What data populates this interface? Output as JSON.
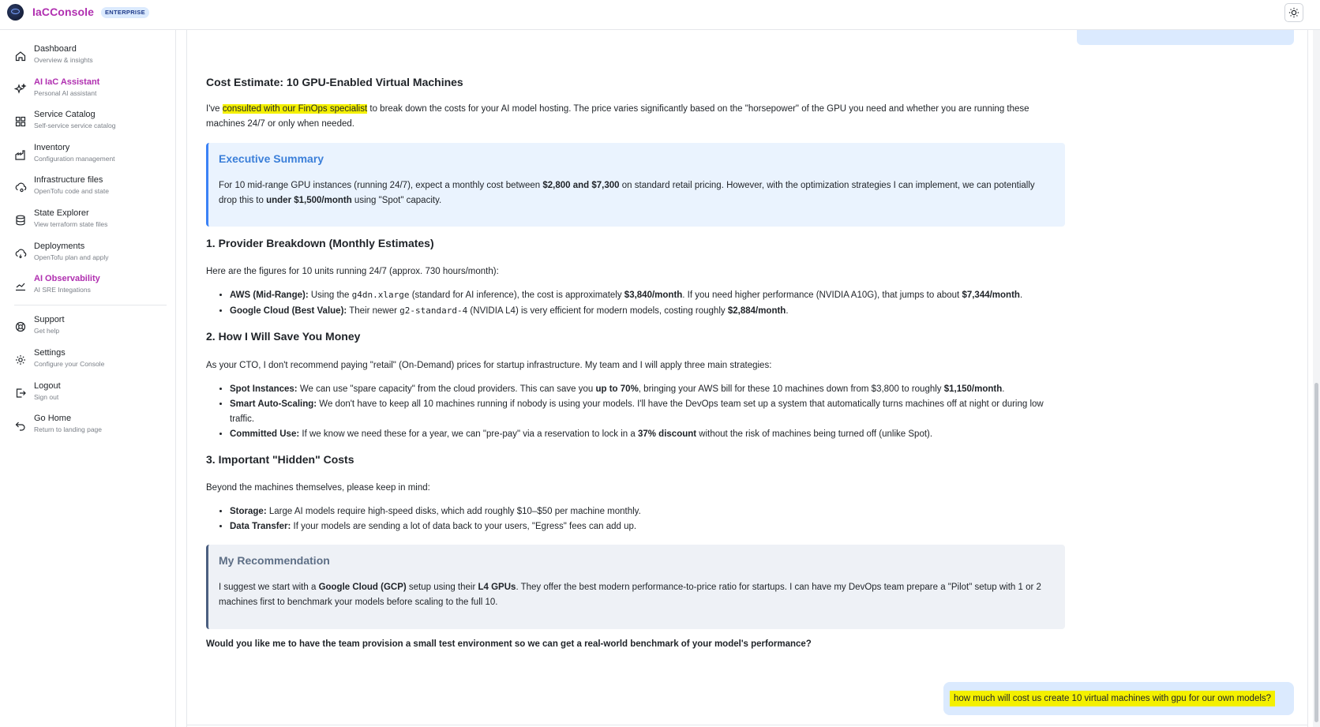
{
  "app": {
    "brand": "IaCConsole",
    "badge": "ENTERPRISE"
  },
  "sidebar": {
    "items": [
      {
        "label": "Dashboard",
        "sub": "Overview & insights"
      },
      {
        "label": "AI IaC Assistant",
        "sub": "Personal AI assistant"
      },
      {
        "label": "Service Catalog",
        "sub": "Self-service service catalog"
      },
      {
        "label": "Inventory",
        "sub": "Configuration management"
      },
      {
        "label": "Infrastructure files",
        "sub": "OpenTofu code and state"
      },
      {
        "label": "State Explorer",
        "sub": "View terraform state files"
      },
      {
        "label": "Deployments",
        "sub": "OpenTofu plan and apply"
      },
      {
        "label": "AI Observability",
        "sub": "AI SRE Integations"
      }
    ],
    "bottom_items": [
      {
        "label": "Support",
        "sub": "Get help"
      },
      {
        "label": "Settings",
        "sub": "Configure your Console"
      },
      {
        "label": "Logout",
        "sub": "Sign out"
      },
      {
        "label": "Go Home",
        "sub": "Return to landing page"
      }
    ]
  },
  "chat": {
    "title": "Cost Estimate: 10 GPU-Enabled Virtual Machines",
    "intro_pre": "I've ",
    "intro_highlight": "consulted with our FinOps specialist",
    "intro_post": " to break down the costs for your AI model hosting. The price varies significantly based on the \"horsepower\" of the GPU you need and whether you are running these machines 24/7 or only when needed.",
    "exec_title": "Executive Summary",
    "exec_1": "For 10 mid-range GPU instances (running 24/7), expect a monthly cost between ",
    "exec_2": "$2,800 and $7,300",
    "exec_3": " on standard retail pricing. However, with the optimization strategies I can implement, we can potentially drop this to ",
    "exec_4": "under $1,500/month",
    "exec_5": " using \"Spot\" capacity.",
    "s1_title": "1. Provider Breakdown (Monthly Estimates)",
    "s1_text": "Here are the figures for 10 units running 24/7 (approx. 730 hours/month):",
    "s1_b1_label": "AWS (Mid-Range):",
    "s1_b1_a": " Using the ",
    "s1_b1_code": "g4dn.xlarge",
    "s1_b1_b": " (standard for AI inference), the cost is approximately ",
    "s1_b1_v1": "$3,840/month",
    "s1_b1_c": ". If you need higher performance (NVIDIA A10G), that jumps to about ",
    "s1_b1_v2": "$7,344/month",
    "s1_b1_d": ".",
    "s1_b2_label": "Google Cloud (Best Value):",
    "s1_b2_a": " Their newer ",
    "s1_b2_code": "g2-standard-4",
    "s1_b2_b": " (NVIDIA L4) is very efficient for modern models, costing roughly ",
    "s1_b2_v": "$2,884/month",
    "s1_b2_c": ".",
    "s2_title": "2. How I Will Save You Money",
    "s2_text": "As your CTO, I don't recommend paying \"retail\" (On-Demand) prices for startup infrastructure. My team and I will apply three main strategies:",
    "s2_b1_label": "Spot Instances:",
    "s2_b1_a": " We can use \"spare capacity\" from the cloud providers. This can save you ",
    "s2_b1_v1": "up to 70%",
    "s2_b1_b": ", bringing your AWS bill for these 10 machines down from $3,800 to roughly ",
    "s2_b1_v2": "$1,150/month",
    "s2_b1_c": ".",
    "s2_b2_label": "Smart Auto-Scaling:",
    "s2_b2_a": " We don't have to keep all 10 machines running if nobody is using your models. I'll have the DevOps team set up a system that automatically turns machines off at night or during low traffic.",
    "s2_b3_label": "Committed Use:",
    "s2_b3_a": " If we know we need these for a year, we can \"pre-pay\" via a reservation to lock in a ",
    "s2_b3_v": "37% discount",
    "s2_b3_b": " without the risk of machines being turned off (unlike Spot).",
    "s3_title": "3. Important \"Hidden\" Costs",
    "s3_text": "Beyond the machines themselves, please keep in mind:",
    "s3_b1_label": "Storage:",
    "s3_b1_a": " Large AI models require high-speed disks, which add roughly $10–$50 per machine monthly.",
    "s3_b2_label": "Data Transfer:",
    "s3_b2_a": " If your models are sending a lot of data back to your users, \"Egress\" fees can add up.",
    "rec_title": "My Recommendation",
    "rec_1": "I suggest we start with a ",
    "rec_2": "Google Cloud (GCP)",
    "rec_3": " setup using their ",
    "rec_4": "L4 GPUs",
    "rec_5": ". They offer the best modern performance-to-price ratio for startups. I can have my DevOps team prepare a \"Pilot\" setup with 1 or 2 machines first to benchmark your models before scaling to the full 10.",
    "question": "Would you like me to have the team provision a small test environment so we can get a real-world benchmark of your model's performance?",
    "user_message": "how much will cost us create 10 virtual machines with gpu for our own models?"
  },
  "colors": {
    "brand": "#b02fb0",
    "highlight": "#f4f000",
    "accent_blue": "#3b82f6",
    "user_bubble": "#dbeafe"
  }
}
